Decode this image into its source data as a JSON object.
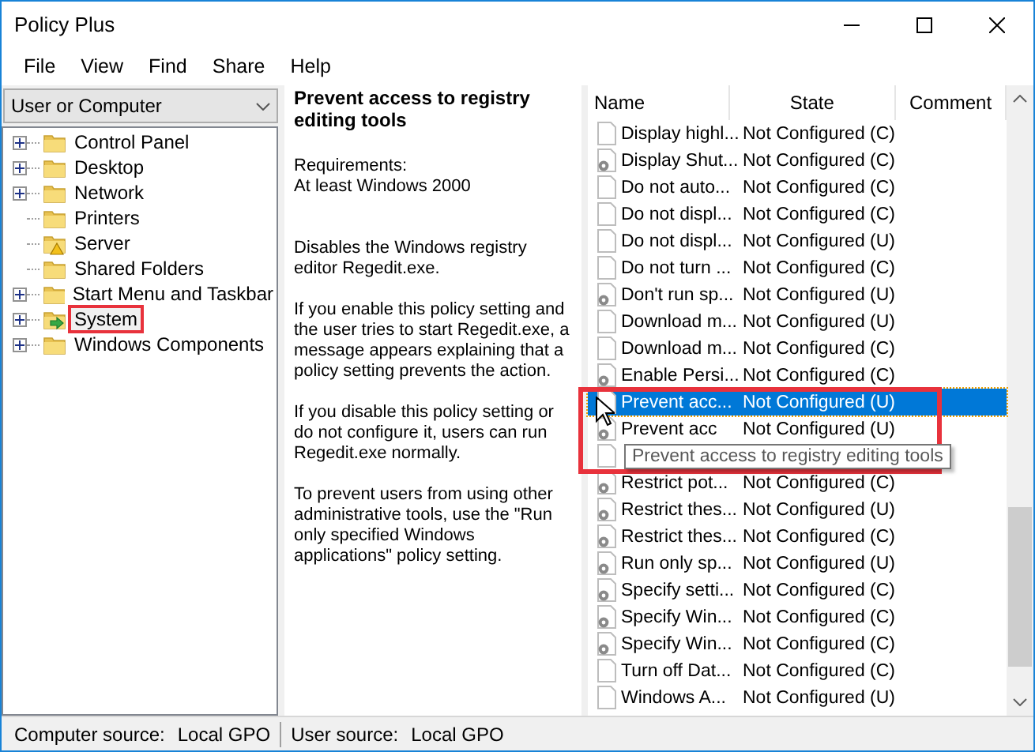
{
  "window": {
    "title": "Policy Plus"
  },
  "menu": [
    "File",
    "View",
    "Find",
    "Share",
    "Help"
  ],
  "scope_dropdown": {
    "value": "User or Computer"
  },
  "tree": [
    {
      "label": "Control Panel",
      "kind": "folder",
      "expanded": false,
      "highlighted": false,
      "selected": false
    },
    {
      "label": "Desktop",
      "kind": "folder",
      "expanded": false,
      "highlighted": false,
      "selected": false
    },
    {
      "label": "Network",
      "kind": "folder",
      "expanded": false,
      "highlighted": false,
      "selected": false
    },
    {
      "label": "Printers",
      "kind": "folder",
      "highlighted": false,
      "selected": false
    },
    {
      "label": "Server",
      "kind": "warning",
      "highlighted": false,
      "selected": false
    },
    {
      "label": "Shared Folders",
      "kind": "folder",
      "highlighted": false,
      "selected": false
    },
    {
      "label": "Start Menu and Taskbar",
      "kind": "folder",
      "expanded": false,
      "highlighted": false,
      "selected": false
    },
    {
      "label": "System",
      "kind": "arrow",
      "expanded": false,
      "highlighted": true,
      "selected": true
    },
    {
      "label": "Windows Components",
      "kind": "folder",
      "expanded": false,
      "highlighted": false,
      "selected": false
    }
  ],
  "description": {
    "title": "Prevent access to registry editing tools",
    "paragraphs": [
      "Requirements:\nAt least Windows 2000",
      "Disables the Windows registry editor Regedit.exe.",
      "If you enable this policy setting and the user tries to start Regedit.exe, a message appears explaining that a policy setting prevents the action.",
      "If you disable this policy setting or do not configure it, users can run Regedit.exe normally.",
      "To prevent users from using other administrative tools, use the \"Run only specified Windows applications\" policy setting."
    ]
  },
  "table": {
    "columns": [
      "Name",
      "State",
      "Comment"
    ],
    "rows": [
      {
        "kind": "page",
        "name": "Display highl...",
        "state": "Not Configured (C)",
        "selected": false,
        "highlighted": false
      },
      {
        "kind": "gear",
        "name": "Display Shut...",
        "state": "Not Configured (C)",
        "selected": false,
        "highlighted": false
      },
      {
        "kind": "page",
        "name": "Do not auto...",
        "state": "Not Configured (C)",
        "selected": false,
        "highlighted": false
      },
      {
        "kind": "page",
        "name": "Do not displ...",
        "state": "Not Configured (C)",
        "selected": false,
        "highlighted": false
      },
      {
        "kind": "page",
        "name": "Do not displ...",
        "state": "Not Configured (U)",
        "selected": false,
        "highlighted": false
      },
      {
        "kind": "page",
        "name": "Do not turn ...",
        "state": "Not Configured (C)",
        "selected": false,
        "highlighted": false
      },
      {
        "kind": "gear",
        "name": "Don't run sp...",
        "state": "Not Configured (U)",
        "selected": false,
        "highlighted": false
      },
      {
        "kind": "page",
        "name": "Download m...",
        "state": "Not Configured (U)",
        "selected": false,
        "highlighted": false
      },
      {
        "kind": "page",
        "name": "Download m...",
        "state": "Not Configured (C)",
        "selected": false,
        "highlighted": false
      },
      {
        "kind": "gear",
        "name": "Enable Persi...",
        "state": "Not Configured (C)",
        "selected": false,
        "highlighted": false
      },
      {
        "kind": "page",
        "name": "Prevent acc...",
        "state": "Not Configured (U)",
        "selected": true,
        "highlighted": true
      },
      {
        "kind": "gear",
        "name": "Prevent acc",
        "state": "Not Configured (U)",
        "selected": false,
        "highlighted": false
      },
      {
        "kind": "page",
        "selected": false,
        "highlighted": false
      },
      {
        "kind": "gear",
        "name": "Restrict pot...",
        "state": "Not Configured (C)",
        "selected": false,
        "highlighted": false
      },
      {
        "kind": "gear",
        "name": "Restrict thes...",
        "state": "Not Configured (U)",
        "selected": false,
        "highlighted": false
      },
      {
        "kind": "gear",
        "name": "Restrict thes...",
        "state": "Not Configured (C)",
        "selected": false,
        "highlighted": false
      },
      {
        "kind": "gear",
        "name": "Run only sp...",
        "state": "Not Configured (U)",
        "selected": false,
        "highlighted": false
      },
      {
        "kind": "gear",
        "name": "Specify setti...",
        "state": "Not Configured (C)",
        "selected": false,
        "highlighted": false
      },
      {
        "kind": "gear",
        "name": "Specify Win...",
        "state": "Not Configured (C)",
        "selected": false,
        "highlighted": false
      },
      {
        "kind": "gear",
        "name": "Specify Win...",
        "state": "Not Configured (C)",
        "selected": false,
        "highlighted": false
      },
      {
        "kind": "page",
        "name": "Turn off Dat...",
        "state": "Not Configured (C)",
        "selected": false,
        "highlighted": false
      },
      {
        "kind": "page",
        "name": "Windows A...",
        "state": "Not Configured (U)",
        "selected": false,
        "highlighted": false
      }
    ]
  },
  "tooltip": "Prevent access to registry editing tools",
  "status_bar": [
    "Computer source:",
    "Local GPO",
    "User source:",
    "Local GPO"
  ]
}
